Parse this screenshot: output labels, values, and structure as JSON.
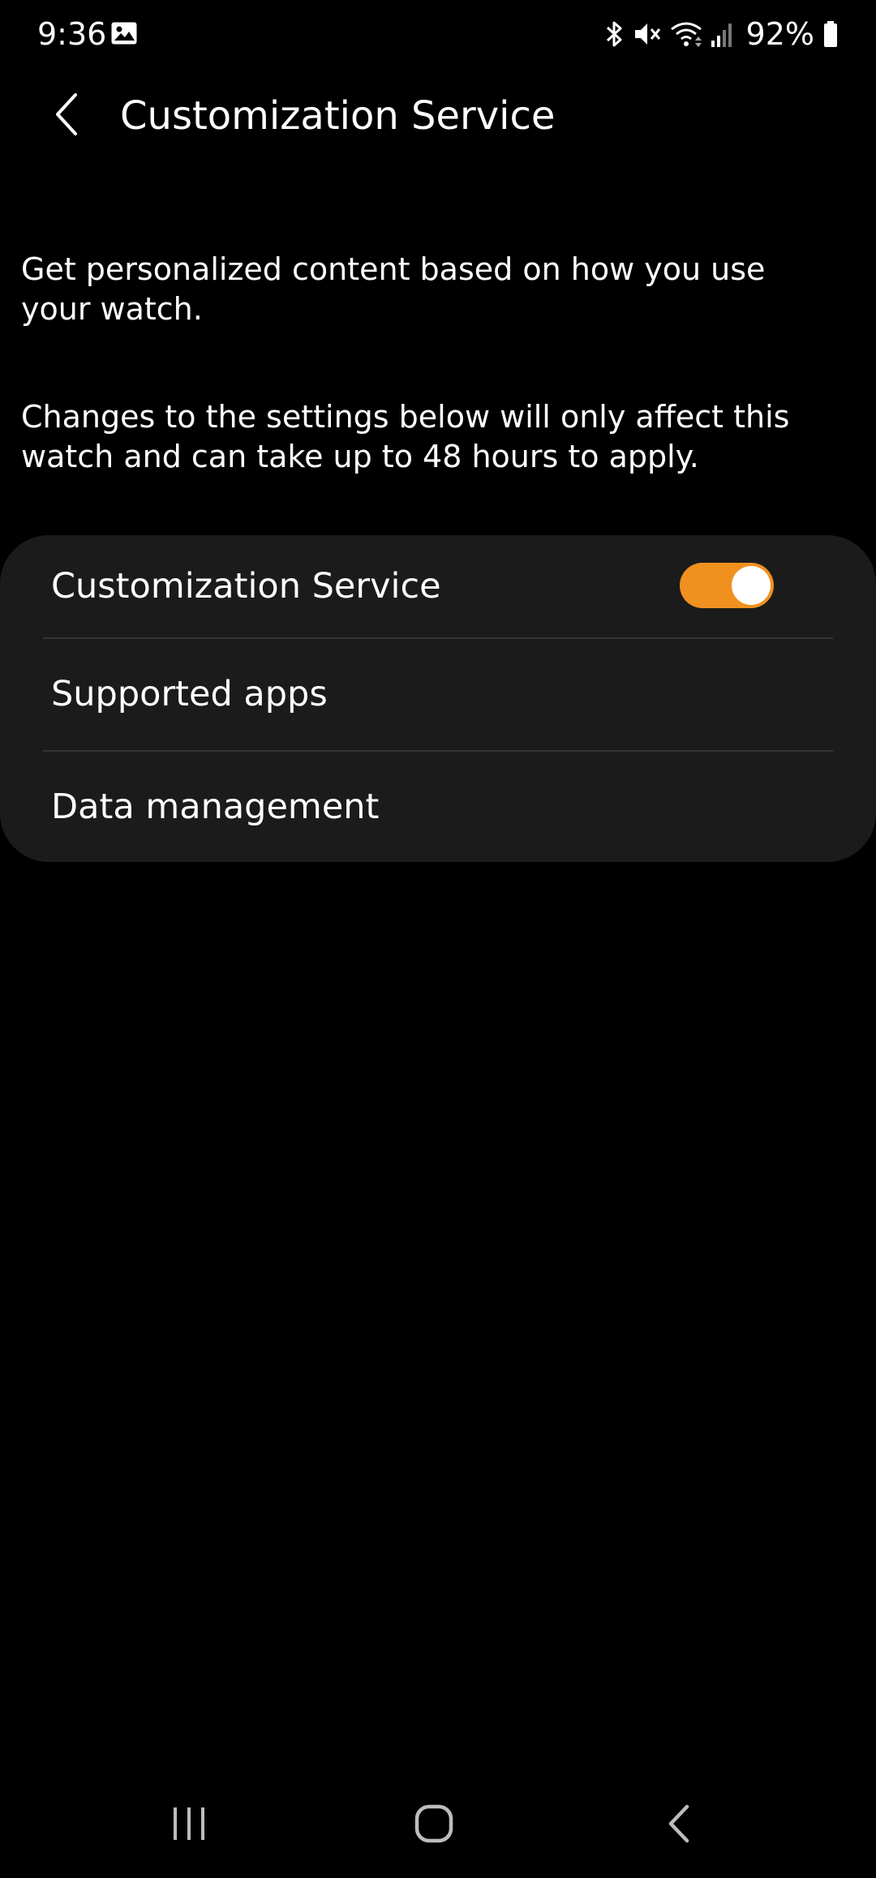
{
  "status_bar": {
    "time": "9:36",
    "battery_percent": "92%",
    "battery_level": 0.92,
    "icons": [
      "gallery-icon",
      "bluetooth-icon",
      "mute-icon",
      "wifi-icon",
      "signal-icon",
      "battery-icon"
    ]
  },
  "app_bar": {
    "title": "Customization Service",
    "back_icon": "chevron-left-icon"
  },
  "description": {
    "line1": "Get personalized content based on how you use your watch.",
    "line2": "Changes to the settings below will only affect this watch and can take up to 48 hours to apply."
  },
  "settings": {
    "items": [
      {
        "label": "Customization Service",
        "toggle": true
      },
      {
        "label": "Supported apps"
      },
      {
        "label": "Data management"
      }
    ]
  },
  "colors": {
    "background": "#000000",
    "card": "#1b1b1b",
    "accent": "#f0901f",
    "text": "#ffffff",
    "divider": "#333333"
  },
  "nav_bar": {
    "icons": [
      "recents-icon",
      "home-icon",
      "back-icon"
    ]
  }
}
